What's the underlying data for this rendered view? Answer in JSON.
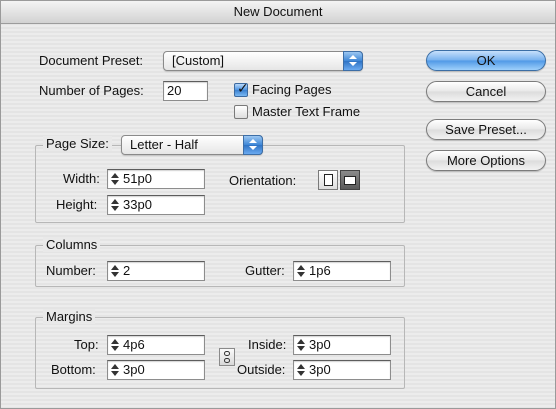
{
  "window": {
    "title": "New Document"
  },
  "document_preset": {
    "label": "Document Preset:",
    "value": "[Custom]"
  },
  "pages": {
    "label": "Number of Pages:",
    "value": "20"
  },
  "facing_pages": {
    "label": "Facing Pages",
    "checked": true
  },
  "master_text_frame": {
    "label": "Master Text Frame",
    "checked": false
  },
  "buttons": {
    "ok": "OK",
    "cancel": "Cancel",
    "save_preset": "Save Preset...",
    "more_options": "More Options"
  },
  "page_size": {
    "label": "Page Size:",
    "value": "Letter - Half",
    "width_label": "Width:",
    "width": "51p0",
    "height_label": "Height:",
    "height": "33p0",
    "orientation_label": "Orientation:",
    "orientation_selected": "landscape"
  },
  "columns": {
    "title": "Columns",
    "number_label": "Number:",
    "number": "2",
    "gutter_label": "Gutter:",
    "gutter": "1p6"
  },
  "margins": {
    "title": "Margins",
    "top_label": "Top:",
    "top": "4p6",
    "bottom_label": "Bottom:",
    "bottom": "3p0",
    "inside_label": "Inside:",
    "inside": "3p0",
    "outside_label": "Outside:",
    "outside": "3p0"
  },
  "colors": {
    "accent": "#4f98e6",
    "background": "#ececec"
  }
}
